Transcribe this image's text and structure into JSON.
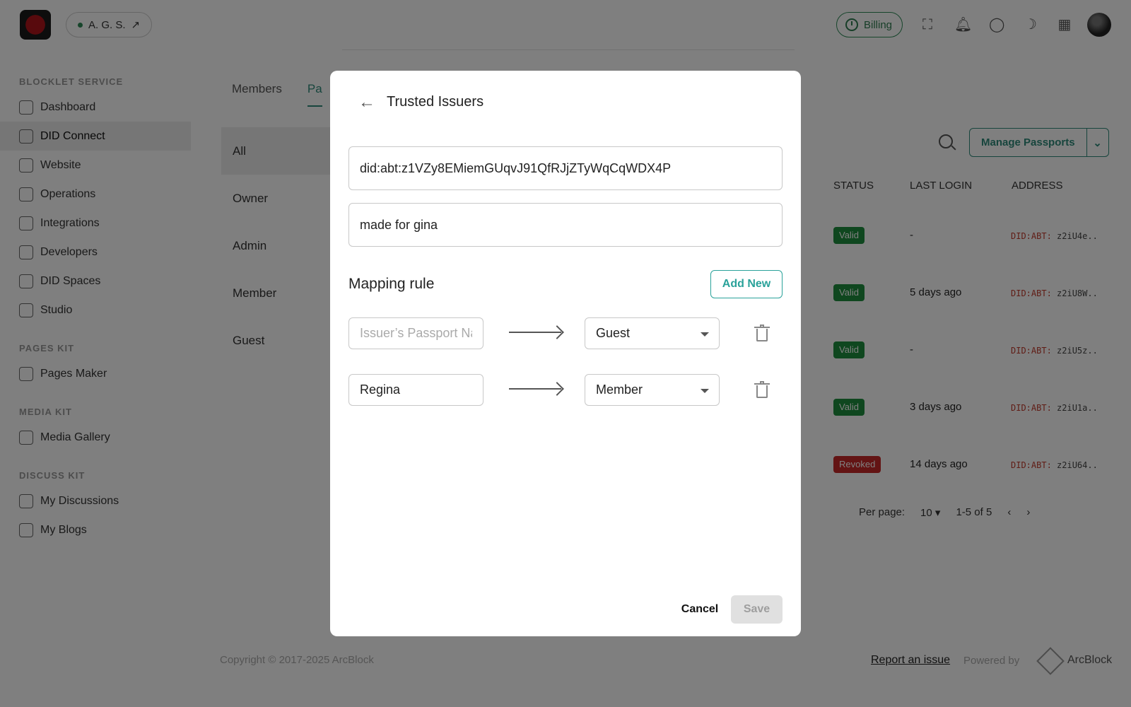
{
  "header": {
    "site_name": "A. G. S.",
    "site_link_icon": "external-link-icon",
    "billing_label": "Billing",
    "icons": [
      "fullscreen-icon",
      "bell-icon",
      "globe-icon",
      "moon-icon",
      "apps-grid-icon"
    ]
  },
  "sidebar": {
    "sections": [
      {
        "title": "BLOCKLET SERVICE",
        "items": [
          {
            "label": "Dashboard",
            "icon": "dashboard-icon"
          },
          {
            "label": "DID Connect",
            "icon": "users-icon",
            "active": true
          },
          {
            "label": "Website",
            "icon": "website-icon"
          },
          {
            "label": "Operations",
            "icon": "wrench-icon"
          },
          {
            "label": "Integrations",
            "icon": "integrations-icon"
          },
          {
            "label": "Developers",
            "icon": "terminal-icon"
          },
          {
            "label": "DID Spaces",
            "icon": "storage-icon"
          },
          {
            "label": "Studio",
            "icon": "studio-icon"
          }
        ]
      },
      {
        "title": "PAGES KIT",
        "items": [
          {
            "label": "Pages Maker",
            "icon": "pages-icon"
          }
        ]
      },
      {
        "title": "MEDIA KIT",
        "items": [
          {
            "label": "Media Gallery",
            "icon": "gallery-icon"
          }
        ]
      },
      {
        "title": "DISCUSS KIT",
        "items": [
          {
            "label": "My Discussions",
            "icon": "chat-icon"
          },
          {
            "label": "My Blogs",
            "icon": "blog-icon"
          }
        ]
      }
    ]
  },
  "main": {
    "tabs": [
      "Members",
      "Pa"
    ],
    "roles": [
      "All",
      "Owner",
      "Admin",
      "Member",
      "Guest"
    ],
    "manage_button": "Manage Passports",
    "columns": [
      "STATUS",
      "LAST LOGIN",
      "ADDRESS"
    ],
    "rows": [
      {
        "status": "Valid",
        "last_login": "-",
        "addr_prefix": "DID:ABT:",
        "addr": "z2iU4e.."
      },
      {
        "status": "Valid",
        "last_login": "5 days ago",
        "addr_prefix": "DID:ABT:",
        "addr": "z2iU8W.."
      },
      {
        "status": "Valid",
        "last_login": "-",
        "addr_prefix": "DID:ABT:",
        "addr": "z2iU5z.."
      },
      {
        "status": "Valid",
        "last_login": "3 days ago",
        "addr_prefix": "DID:ABT:",
        "addr": "z2iU1a.."
      },
      {
        "status": "Revoked",
        "last_login": "14 days ago",
        "addr_prefix": "DID:ABT:",
        "addr": "z2iU64.."
      }
    ],
    "pagination": {
      "per_page_label": "Per page:",
      "per_page": "10",
      "range": "1-5 of 5"
    }
  },
  "footer": {
    "copyright": "Copyright © 2017-2025 ArcBlock",
    "report": "Report an issue",
    "powered_by": "Powered by",
    "brand": "ArcBlock"
  },
  "modal": {
    "title": "Trusted Issuers",
    "did_value": "did:abt:z1VZy8EMiemGUqvJ91QfRJjZTyWqCqWDX4P",
    "remark_value": "made for gina",
    "mapping_label": "Mapping rule",
    "add_new": "Add New",
    "rules": [
      {
        "input_value": "",
        "input_placeholder": "Issuer’s Passport Name",
        "role": "Guest"
      },
      {
        "input_value": "Regina",
        "input_placeholder": "Issuer’s Passport Name",
        "role": "Member"
      }
    ],
    "cancel": "Cancel",
    "save": "Save"
  }
}
